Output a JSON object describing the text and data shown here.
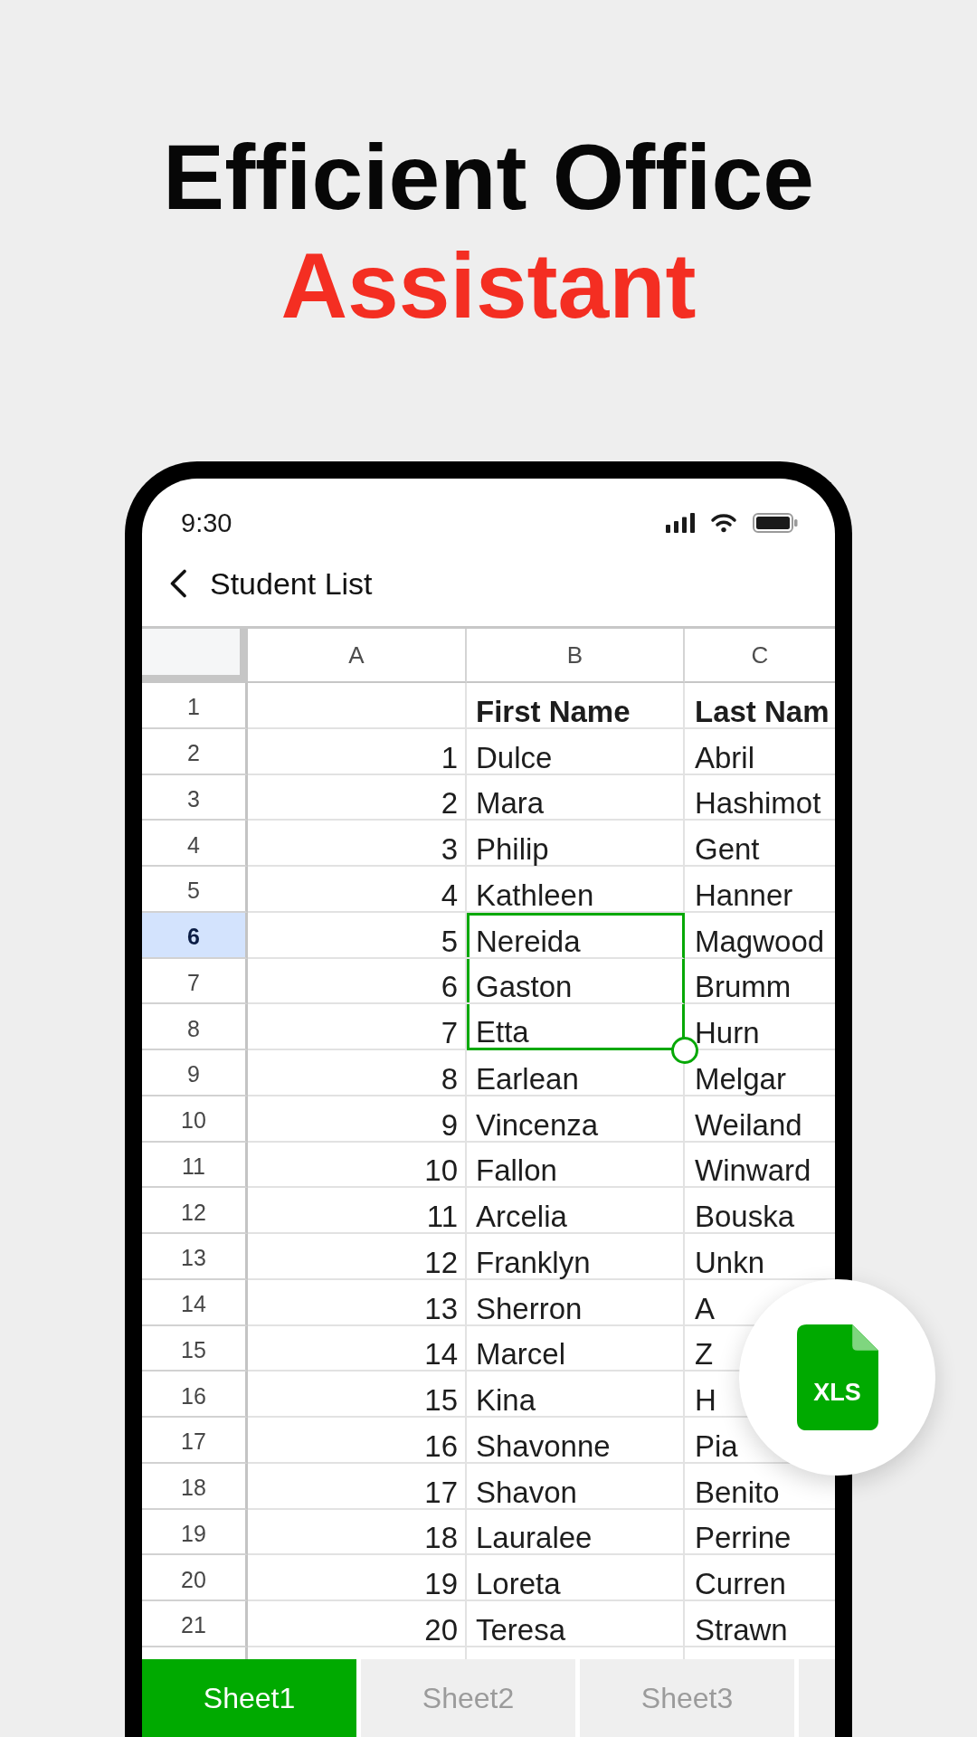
{
  "headline": [
    {
      "kind": "plain",
      "text": "Efficient Office"
    },
    {
      "kind": "accent",
      "text": "Assistant"
    }
  ],
  "status_bar": {
    "time": "9:30"
  },
  "app_bar": {
    "title": "Student List"
  },
  "sheet": {
    "columns": [
      "A",
      "B",
      "C"
    ],
    "rows": [
      {
        "number": "1",
        "kind": "header",
        "b": "First Name",
        "c": "Last Nam",
        "current": false,
        "selected": false
      },
      {
        "number": "2",
        "kind": "data",
        "a": "1",
        "b": "Dulce",
        "c": "Abril",
        "current": false,
        "selected": false
      },
      {
        "number": "3",
        "kind": "data",
        "a": "2",
        "b": "Mara",
        "c": "Hashimot",
        "current": false,
        "selected": false
      },
      {
        "number": "4",
        "kind": "data",
        "a": "3",
        "b": "Philip",
        "c": "Gent",
        "current": false,
        "selected": false
      },
      {
        "number": "5",
        "kind": "data",
        "a": "4",
        "b": "Kathleen",
        "c": "Hanner",
        "current": false,
        "selected": false
      },
      {
        "number": "6",
        "kind": "data",
        "a": "5",
        "b": "Nereida",
        "c": "Magwood",
        "current": true,
        "selected": true
      },
      {
        "number": "7",
        "kind": "data",
        "a": "6",
        "b": "Gaston",
        "c": "Brumm",
        "current": false,
        "selected": true
      },
      {
        "number": "8",
        "kind": "data",
        "a": "7",
        "b": "Etta",
        "c": "Hurn",
        "current": false,
        "selected": true
      },
      {
        "number": "9",
        "kind": "data",
        "a": "8",
        "b": "Earlean",
        "c": "Melgar",
        "current": false,
        "selected": false
      },
      {
        "number": "10",
        "kind": "data",
        "a": "9",
        "b": "Vincenza",
        "c": "Weiland",
        "current": false,
        "selected": false
      },
      {
        "number": "11",
        "kind": "data",
        "a": "10",
        "b": "Fallon",
        "c": "Winward",
        "current": false,
        "selected": false
      },
      {
        "number": "12",
        "kind": "data",
        "a": "11",
        "b": "Arcelia",
        "c": "Bouska",
        "current": false,
        "selected": false
      },
      {
        "number": "13",
        "kind": "data",
        "a": "12",
        "b": "Franklyn",
        "c": "Unkn",
        "current": false,
        "selected": false
      },
      {
        "number": "14",
        "kind": "data",
        "a": "13",
        "b": "Sherron",
        "c": "A",
        "current": false,
        "selected": false
      },
      {
        "number": "15",
        "kind": "data",
        "a": "14",
        "b": "Marcel",
        "c": "Z",
        "current": false,
        "selected": false
      },
      {
        "number": "16",
        "kind": "data",
        "a": "15",
        "b": "Kina",
        "c": "H",
        "current": false,
        "selected": false
      },
      {
        "number": "17",
        "kind": "data",
        "a": "16",
        "b": "Shavonne",
        "c": "Pia",
        "current": false,
        "selected": false
      },
      {
        "number": "18",
        "kind": "data",
        "a": "17",
        "b": "Shavon",
        "c": "Benito",
        "current": false,
        "selected": false
      },
      {
        "number": "19",
        "kind": "data",
        "a": "18",
        "b": "Lauralee",
        "c": "Perrine",
        "current": false,
        "selected": false
      },
      {
        "number": "20",
        "kind": "data",
        "a": "19",
        "b": "Loreta",
        "c": "Curren",
        "current": false,
        "selected": false
      },
      {
        "number": "21",
        "kind": "data",
        "a": "20",
        "b": "Teresa",
        "c": "Strawn",
        "current": false,
        "selected": false
      }
    ]
  },
  "sheet_tabs": [
    {
      "label": "Sheet1",
      "selected": true
    },
    {
      "label": "Sheet2",
      "selected": false
    },
    {
      "label": "Sheet3",
      "selected": false
    },
    {
      "selected": false
    }
  ],
  "file_badge": {
    "label": "XLS"
  }
}
